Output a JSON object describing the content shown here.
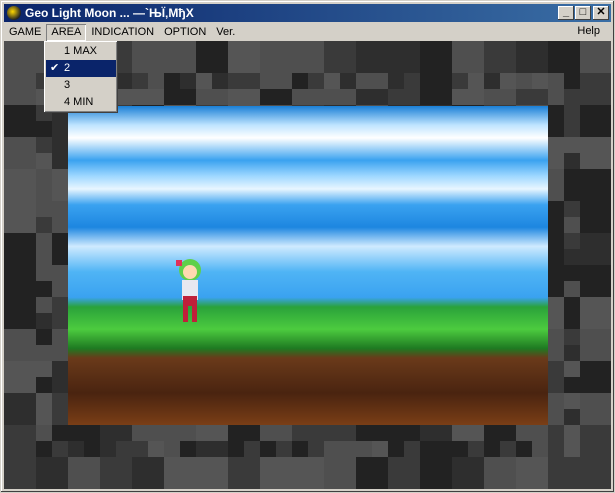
{
  "window": {
    "title": "Geo Light Moon ... ―`ЊЇ‚МђX",
    "minimize": "_",
    "maximize": "□",
    "close": "✕"
  },
  "menubar": {
    "items": [
      "GAME",
      "AREA",
      "INDICATION",
      "OPTION",
      "Ver."
    ],
    "help": "Help"
  },
  "area_menu": {
    "items": [
      {
        "label": "1 MAX",
        "checked": false
      },
      {
        "label": "2",
        "checked": true
      },
      {
        "label": "3",
        "checked": false
      },
      {
        "label": "4 MIN",
        "checked": false
      }
    ],
    "check": "✔"
  },
  "colors": {
    "titlebar": "#0a246a",
    "selection": "#0a246a"
  }
}
